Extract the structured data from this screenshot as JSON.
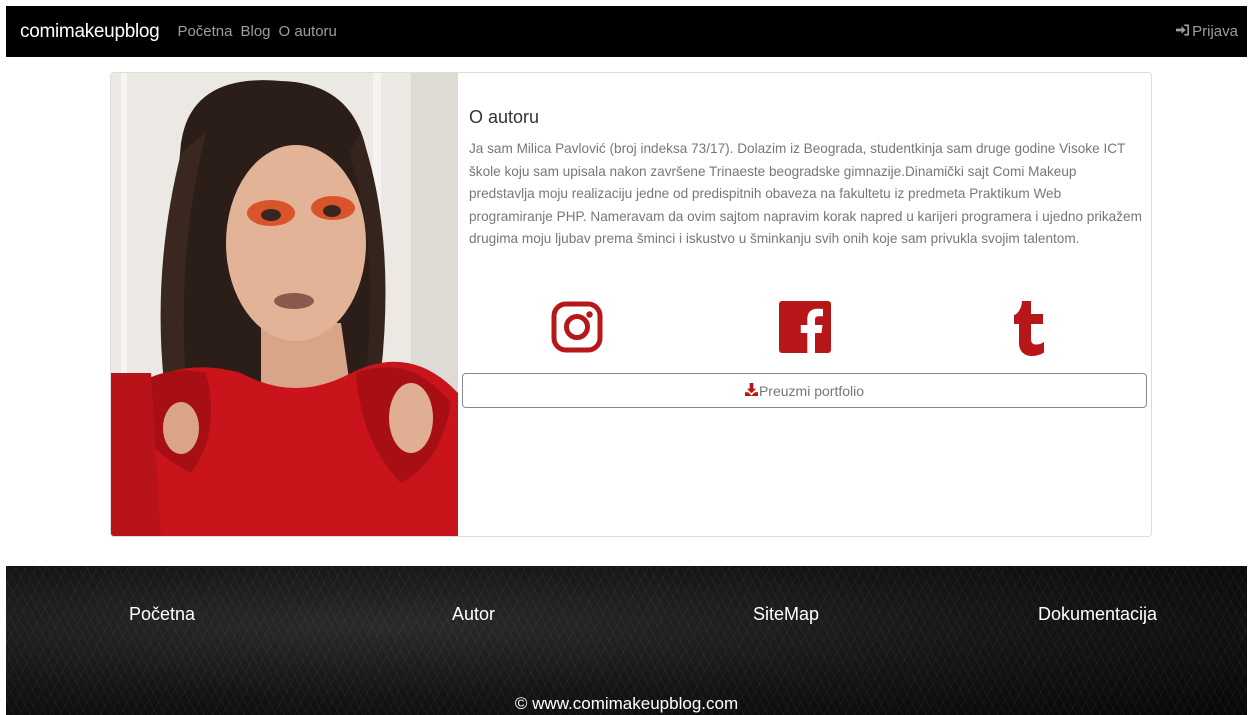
{
  "navbar": {
    "brand": "comimakeupblog",
    "links": [
      "Početna",
      "Blog",
      "O autoru"
    ],
    "login_label": "Prijava",
    "login_icon": "sign-in-icon"
  },
  "about": {
    "title": "O autoru",
    "bio": "Ja sam Milica Pavlović (broj indeksa 73/17). Dolazim iz Beograda, studentkinja sam druge godine Visoke ICT škole koju sam upisala nakon završene Trinaeste beogradske gimnazije.Dinamički sajt Comi Makeup predstavlja moju realizaciju jedne od predispitnih obaveza na fakultetu iz predmeta Praktikum Web programiranje PHP. Nameravam da ovim sajtom napravim korak napred u karijeri programera i ujedno prikažem drugima moju ljubav prema šminci i iskustvo u šminkanju svih onih koje sam privukla svojim talentom.",
    "social_icons": [
      "instagram-icon",
      "facebook-icon",
      "tumblr-icon"
    ],
    "download_label": "Preuzmi portfolio",
    "download_icon": "download-icon",
    "accent_color": "#b8171a"
  },
  "footer": {
    "links": [
      "Početna",
      "Autor",
      "SiteMap",
      "Dokumentacija"
    ],
    "copyright": "© www.comimakeupblog.com"
  }
}
